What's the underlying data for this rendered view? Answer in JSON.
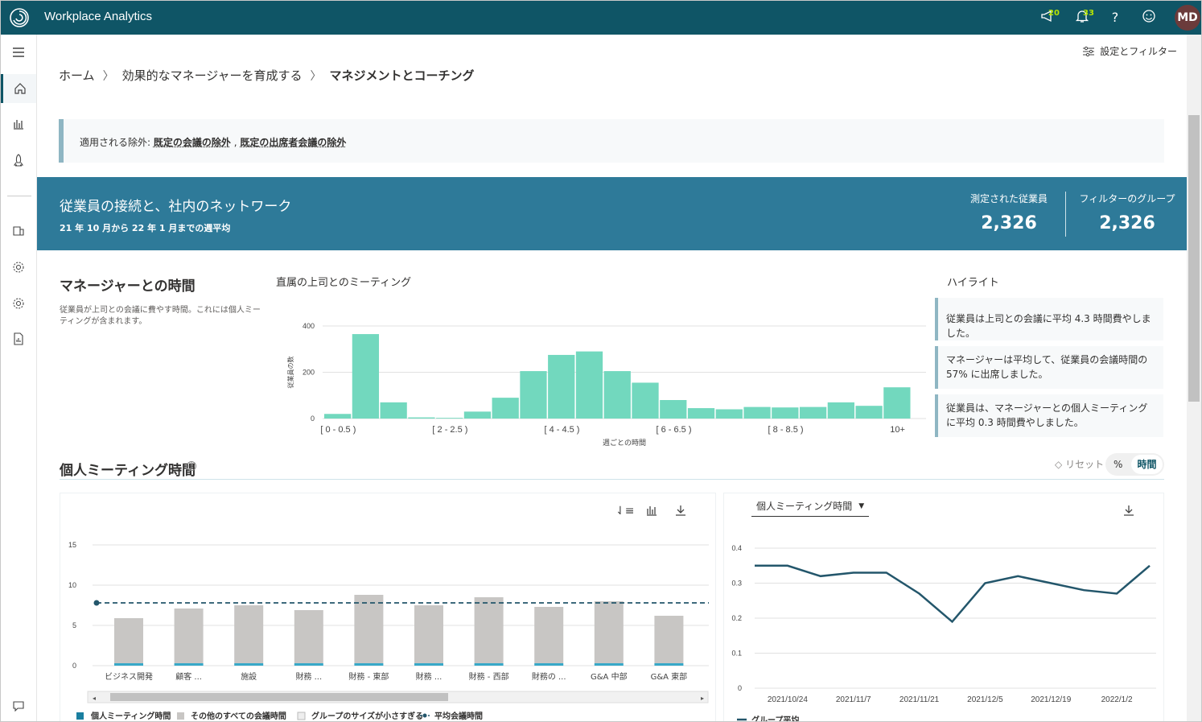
{
  "app": {
    "title": "Workplace Analytics"
  },
  "topbar": {
    "announcements_count": "20",
    "notifications_count": "33",
    "help": "?",
    "avatar": "MD"
  },
  "filter_button": "設定とフィルター",
  "breadcrumb": [
    "ホーム",
    "効果的なマネージャーを育成する",
    "マネジメントとコーチング"
  ],
  "exclusions": {
    "label": "適用される除外:",
    "items": [
      "既定の会議の除外",
      "既定の出席者会議の除外"
    ],
    "separator": ","
  },
  "hero": {
    "title": "従業員の接続と、社内のネットワーク",
    "subtitle": "21 年 10 月から 22 年 1 月までの週平均",
    "measured_label": "測定された従業員",
    "measured_value": "2,326",
    "group_label": "フィルターのグループ",
    "group_value": "2,326"
  },
  "section1": {
    "title": "マネージャーとの時間",
    "description": "従業員が上司との会議に費やす時間。これには個人ミーティングが含まれます。"
  },
  "highlights": {
    "title": "ハイライト",
    "items": [
      "従業員は上司との会議に平均 4.3 時間費やしました。",
      "マネージャーは平均して、従業員の会議時間の 57% に出席しました。",
      "従業員は、マネージャーとの個人ミーティングに平均 0.3 時間費やしました。"
    ]
  },
  "section2": {
    "title": "個人ミーティング時間",
    "reset": "リセット",
    "toggle_pct": "%",
    "toggle_hours": "時間",
    "dropdown": "個人ミーティング時間"
  },
  "colors": {
    "brand": "#0f5566",
    "hero": "#2e7a99",
    "hist": "#72d8be",
    "bar": "#c8c6c4",
    "line": "#23566b"
  },
  "chart_data": [
    {
      "type": "bar",
      "title": "直属の上司とのミーティング",
      "xlabel": "週ごとの時間",
      "ylabel": "従業員の数",
      "tick_labels": [
        "[ 0 - 0.5 )",
        "[ 2 - 2.5 )",
        "[ 4 - 4.5 )",
        "[ 6 - 6.5 )",
        "[ 8 - 8.5 )",
        "10+"
      ],
      "values": [
        20,
        365,
        70,
        5,
        3,
        30,
        90,
        205,
        275,
        290,
        205,
        155,
        80,
        45,
        40,
        50,
        48,
        50,
        70,
        55,
        135
      ],
      "ylim": [
        0,
        400
      ],
      "yticks": [
        0,
        200,
        400
      ]
    },
    {
      "type": "bar",
      "categories": [
        "ビジネス開発",
        "顧客 ...",
        "施設",
        "財務 ...",
        "財務 - 東部",
        "財務 ...",
        "財務 - 西部",
        "財務の ...",
        "G&A 中部",
        "G&A 東部"
      ],
      "series": [
        {
          "name": "個人ミーティング時間",
          "values": [
            0.3,
            0.3,
            0.3,
            0.3,
            0.3,
            0.3,
            0.3,
            0.3,
            0.3,
            0.3
          ]
        },
        {
          "name": "その他のすべての会議時間",
          "values": [
            5.6,
            6.8,
            7.2,
            6.6,
            8.5,
            7.2,
            8.2,
            7.0,
            7.7,
            5.9
          ]
        }
      ],
      "reference_line": {
        "name": "平均会議時間",
        "value": 7.8
      },
      "legend_extra": "グループのサイズが小さすぎる",
      "ylim": [
        0,
        15
      ],
      "yticks": [
        0,
        5,
        10,
        15
      ]
    },
    {
      "type": "line",
      "x": [
        "2021/10/17",
        "2021/10/24",
        "2021/10/31",
        "2021/11/7",
        "2021/11/14",
        "2021/11/21",
        "2021/11/28",
        "2021/12/5",
        "2021/12/12",
        "2021/12/19",
        "2021/12/26",
        "2022/1/2",
        "2022/1/9"
      ],
      "x_tick_labels": [
        "2021/10/24",
        "2021/11/7",
        "2021/11/21",
        "2021/12/5",
        "2021/12/19",
        "2022/1/2"
      ],
      "series": [
        {
          "name": "グループ平均",
          "values": [
            0.35,
            0.35,
            0.32,
            0.33,
            0.33,
            0.27,
            0.19,
            0.3,
            0.32,
            0.3,
            0.28,
            0.27,
            0.35
          ]
        }
      ],
      "ylim": [
        0,
        0.4
      ],
      "yticks": [
        0,
        0.1,
        0.2,
        0.3,
        0.4
      ]
    }
  ]
}
